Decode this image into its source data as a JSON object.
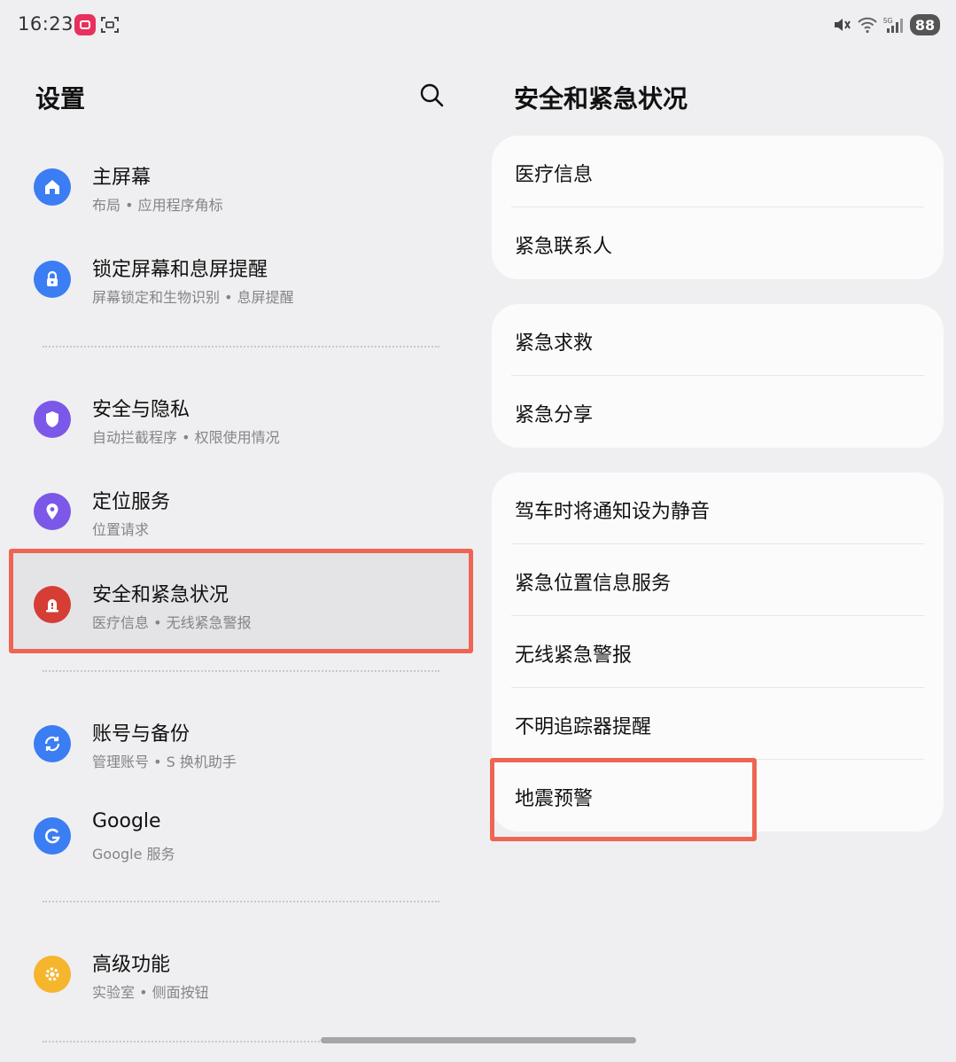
{
  "status_bar": {
    "time": "16:23",
    "battery": "88",
    "icons": [
      "app-badge-icon",
      "scan-icon",
      "mute-icon",
      "wifi-icon",
      "signal-5g-icon",
      "battery-icon"
    ]
  },
  "left_pane": {
    "title": "设置",
    "items": [
      {
        "title": "主屏幕",
        "subtitle": "布局 • 应用程序角标",
        "icon": "home-icon",
        "color": "#3b7df2"
      },
      {
        "title": "锁定屏幕和息屏提醒",
        "subtitle": "屏幕锁定和生物识别 • 息屏提醒",
        "icon": "lock-icon",
        "color": "#3b7df2"
      },
      {
        "title": "安全与隐私",
        "subtitle": "自动拦截程序 • 权限使用情况",
        "icon": "shield-icon",
        "color": "#7b58e8"
      },
      {
        "title": "定位服务",
        "subtitle": "位置请求",
        "icon": "location-pin-icon",
        "color": "#7b58e8"
      },
      {
        "title": "安全和紧急状况",
        "subtitle": "医疗信息 • 无线紧急警报",
        "icon": "emergency-icon",
        "color": "#d63d35"
      },
      {
        "title": "账号与备份",
        "subtitle": "管理账号 • S 换机助手",
        "icon": "sync-icon",
        "color": "#3b7df2"
      },
      {
        "title": "Google",
        "subtitle": "Google 服务",
        "icon": "google-icon",
        "color": "#3b7df2"
      },
      {
        "title": "高级功能",
        "subtitle": "实验室 • 侧面按钮",
        "icon": "gear-icon",
        "color": "#f5b52d"
      }
    ]
  },
  "right_pane": {
    "title": "安全和紧急状况",
    "groups": [
      {
        "items": [
          "医疗信息",
          "紧急联系人"
        ]
      },
      {
        "items": [
          "紧急求救",
          "紧急分享"
        ]
      },
      {
        "items": [
          "驾车时将通知设为静音",
          "紧急位置信息服务",
          "无线紧急警报",
          "不明追踪器提醒",
          "地震预警"
        ]
      }
    ]
  },
  "colors": {
    "background": "#efeff1",
    "card": "#fbfbfc",
    "highlight": "#ee6553"
  }
}
